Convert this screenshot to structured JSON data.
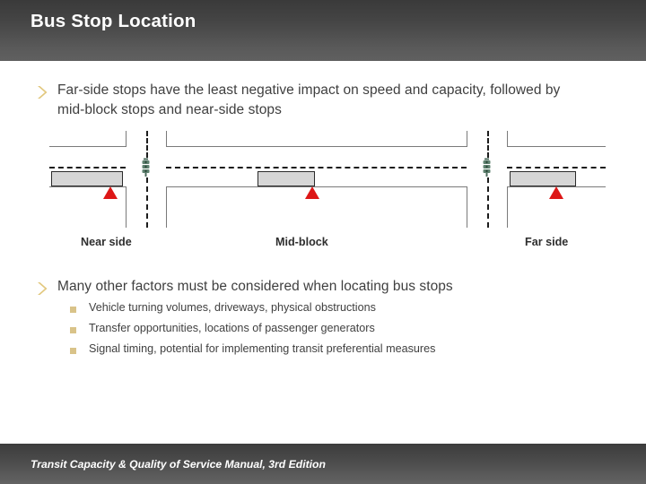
{
  "slide": {
    "title": "Bus Stop Location",
    "footer": "Transit Capacity & Quality of Service Manual, 3rd Edition",
    "accent_color": "#d9c389",
    "header_color": "#4a4a4a",
    "marker_color": "#dd1717"
  },
  "bullets": [
    {
      "text": "Far-side stops have the least negative impact on speed and capacity, followed by mid-block stops and near-side stops",
      "marker": "chevron-right-icon"
    },
    {
      "text": "Many other factors must be considered when locating bus stops",
      "marker": "chevron-right-icon"
    }
  ],
  "sub_bullets": [
    {
      "text": "Vehicle turning volumes, driveways, physical obstructions",
      "marker": "square-bullet-icon"
    },
    {
      "text": "Transfer opportunities, locations of passenger generators",
      "marker": "square-bullet-icon"
    },
    {
      "text": "Signal timing, potential for implementing transit preferential measures",
      "marker": "square-bullet-icon"
    }
  ],
  "diagram": {
    "labels": {
      "near_side": "Near side",
      "mid_block": "Mid-block",
      "far_side": "Far side"
    },
    "elements": {
      "bus_icon": "bus-vehicle-box",
      "stop_icon": "bus-stop-triangle-marker",
      "signal_icon": "traffic-signal-icon"
    }
  }
}
